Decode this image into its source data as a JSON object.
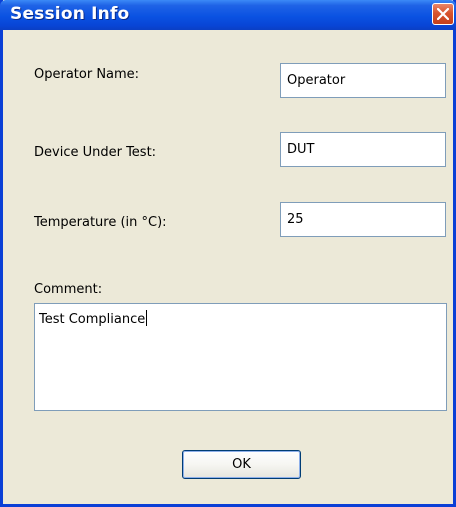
{
  "window": {
    "title": "Session Info"
  },
  "fields": {
    "operator_name": {
      "label": "Operator Name:",
      "value": "Operator"
    },
    "device_under_test": {
      "label": "Device Under Test:",
      "value": "DUT"
    },
    "temperature": {
      "label": "Temperature (in °C):",
      "value": "25"
    },
    "comment": {
      "label": "Comment:",
      "value": "Test Compliance"
    }
  },
  "buttons": {
    "ok_label": "OK"
  },
  "icons": {
    "close": "close-icon"
  },
  "colors": {
    "titlebar": "#0a52e2",
    "close_button": "#d8542e",
    "dialog_background": "#ece9d8",
    "input_border": "#7f9db9"
  }
}
